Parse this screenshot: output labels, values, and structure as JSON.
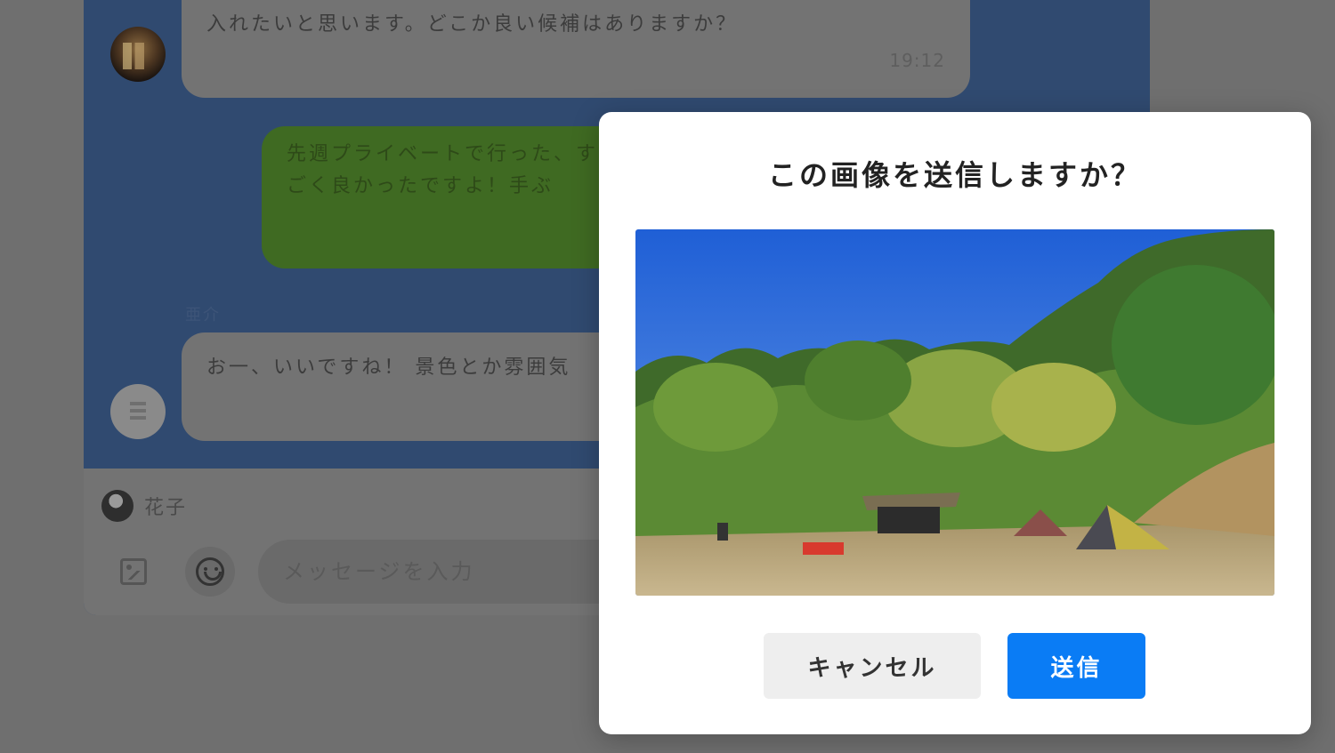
{
  "messages": [
    {
      "text": "入れたいと思います。どこか良い候補はありますか？",
      "time": "19:12"
    },
    {
      "text": "先週プライベートで行った、すごく良かったですよ！手ぶ"
    },
    {
      "sender": "亜介",
      "text": "お一、いいですね！ 景色とか雰囲気"
    }
  ],
  "composer": {
    "user_name": "花子",
    "placeholder": "メッセージを入力"
  },
  "dialog": {
    "title": "この画像を送信しますか？",
    "cancel_label": "キャンセル",
    "send_label": "送信"
  },
  "colors": {
    "send_button": "#0a7cf5",
    "chat_background": "#304a70",
    "overlay": "#6f6f6f"
  }
}
